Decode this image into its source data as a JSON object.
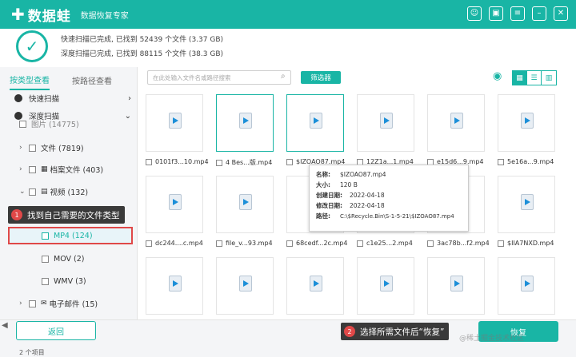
{
  "app": {
    "logo": "数据蛙",
    "subtitle": "数据恢复专家"
  },
  "status": {
    "line1": "快速扫描已完成, 已找到  52439  个文件 (3.37 GB)",
    "line2": "深度扫描已完成, 已找到  88115  个文件 (38.3 GB)"
  },
  "sidebar": {
    "tabs": [
      "按类型查看",
      "按路径查看"
    ],
    "scan_quick": "快速扫描",
    "scan_deep": "深度扫描",
    "partial": "图片 (14775)",
    "items": [
      {
        "label": "文件 (7819)"
      },
      {
        "label": "档案文件 (403)"
      },
      {
        "label": "视频 (132)"
      },
      {
        "label": "MP4 (124)"
      },
      {
        "label": "MOV (2)"
      },
      {
        "label": "WMV (3)"
      },
      {
        "label": "电子邮件 (15)"
      }
    ]
  },
  "annotations": {
    "tip1_num": "1",
    "tip1": "找到自己需要的文件类型",
    "tip2_num": "2",
    "tip2": "选择所需文件后“恢复”"
  },
  "toolbar": {
    "search_placeholder": "在此处输入文件名或路径搜索",
    "filter": "筛选器"
  },
  "files": {
    "row1": [
      "0101f3...10.mp4",
      "4 Bes...版.mp4",
      "$IZOAO87.mp4",
      "12Z1a...1.mp4",
      "e15d6...9.mp4",
      "5e16a...9.mp4"
    ],
    "row2": [
      "dc244....c.mp4",
      "file_v...93.mp4",
      "68cedf...2c.mp4",
      "c1e25...2.mp4",
      "3ac78b...f2.mp4",
      "$IIA7NXD.mp4"
    ]
  },
  "tooltip": {
    "name_k": "名称:",
    "name_v": "$IZOAO87.mp4",
    "size_k": "大小:",
    "size_v": "120 B",
    "created_k": "创建日期:",
    "created_v": "2022-04-18",
    "modified_k": "修改日期:",
    "modified_v": "2022-04-18",
    "path_k": "路径:",
    "path_v": "C:\\$Recycle.Bin\\S-1-5-21\\$IZOAO87.mp4"
  },
  "buttons": {
    "back": "返回",
    "recover": "恢复"
  },
  "footer": {
    "count": "2 个项目",
    "watermark": "@稀土掘金技术社区"
  },
  "colors": {
    "accent": "#19b5a5",
    "annotation_red": "#e04848"
  }
}
